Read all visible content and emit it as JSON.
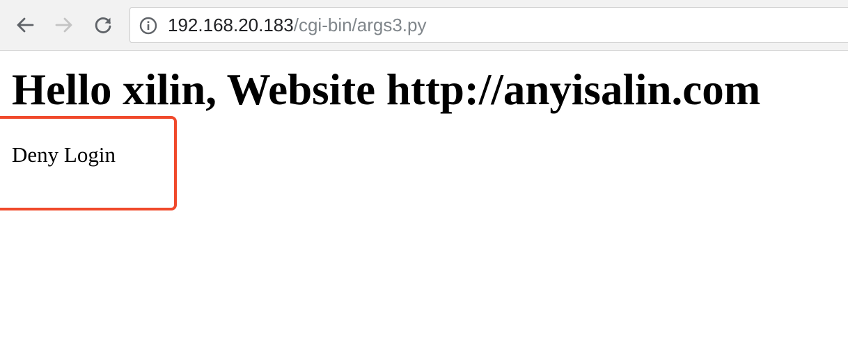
{
  "browser": {
    "back_icon": "arrow-left-icon",
    "forward_icon": "arrow-right-icon",
    "reload_icon": "reload-icon",
    "info_icon": "info-circle-icon",
    "url_host": "192.168.20.183",
    "url_path": "/cgi-bin/args3.py"
  },
  "page": {
    "heading": "Hello xilin, Website http://anyisalin.com",
    "message": "Deny Login"
  },
  "annotation": {
    "color": "#f0492b"
  }
}
